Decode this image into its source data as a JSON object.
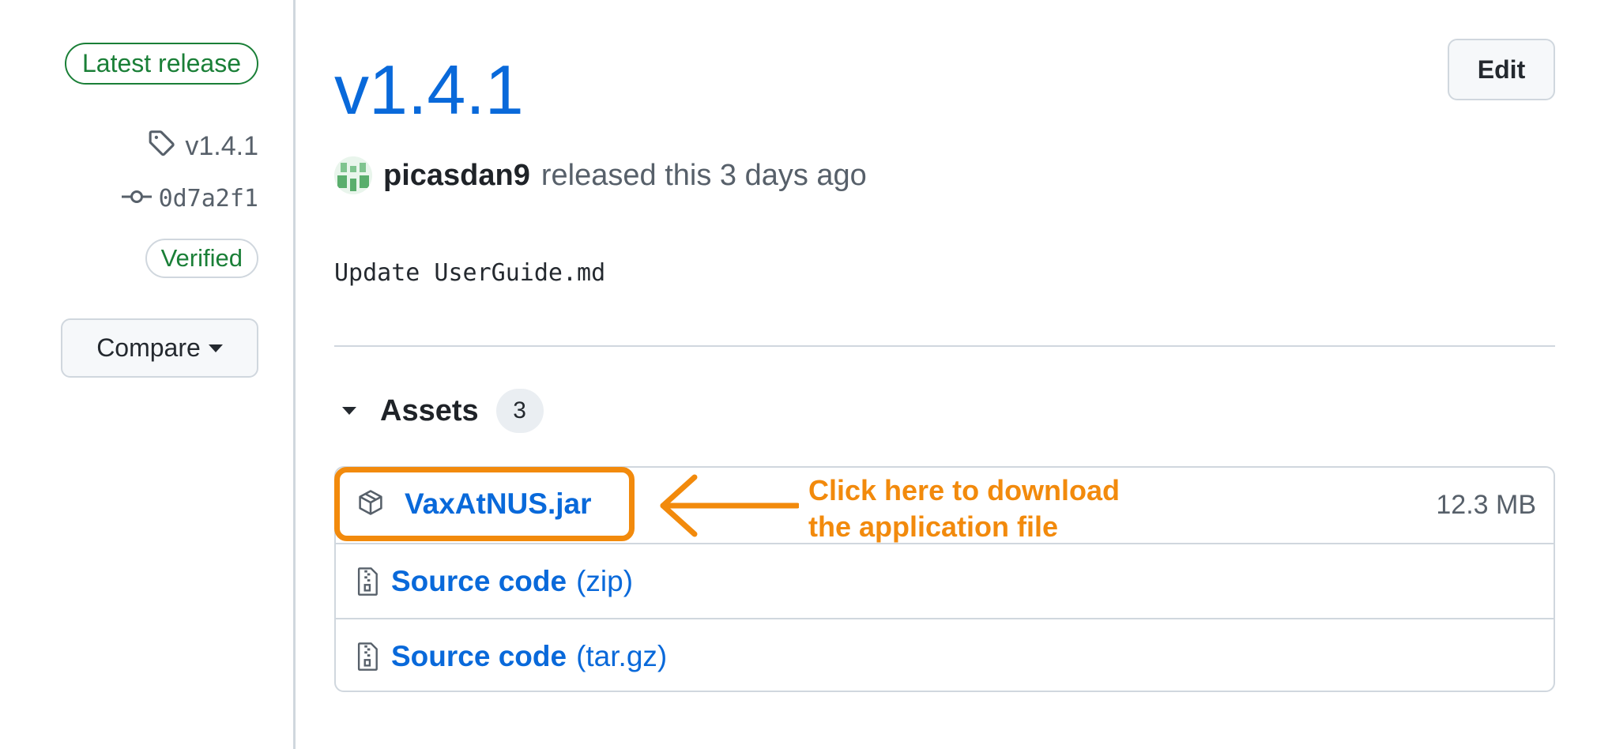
{
  "sidebar": {
    "latest_badge": "Latest release",
    "tag": "v1.4.1",
    "commit": "0d7a2f1",
    "verified": "Verified",
    "compare_label": "Compare"
  },
  "release": {
    "title": "v1.4.1",
    "edit_label": "Edit",
    "author": "picasdan9",
    "released_text": "released this 3 days ago",
    "body": "Update UserGuide.md"
  },
  "assets": {
    "title": "Assets",
    "count": "3",
    "items": [
      {
        "name": "VaxAtNUS.jar",
        "size": "12.3 MB"
      },
      {
        "name": "Source code",
        "ext": "(zip)"
      },
      {
        "name": "Source code",
        "ext": "(tar.gz)"
      }
    ]
  },
  "annotation": {
    "line1": "Click here to download",
    "line2": "the application file"
  },
  "colors": {
    "link": "#0969da",
    "success": "#1a7f37",
    "annotation": "#f28a0c",
    "border": "#d0d7de"
  },
  "icons": [
    "tag-icon",
    "commit-icon",
    "package-icon",
    "file-zip-icon",
    "caret-down-icon",
    "arrow-left-icon"
  ]
}
